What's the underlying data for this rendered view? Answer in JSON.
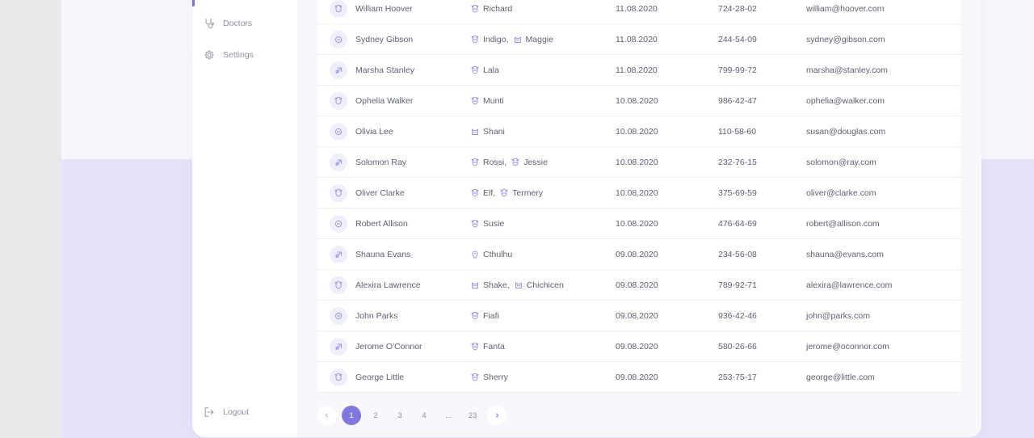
{
  "sidebar": {
    "items": [
      {
        "label": "Doctors",
        "icon": "stethoscope-icon"
      },
      {
        "label": "Settings",
        "icon": "gear-icon"
      }
    ],
    "logout": {
      "label": "Logout",
      "icon": "logout-icon"
    }
  },
  "colors": {
    "accent": "#8178de",
    "icon": "#9b94e6"
  },
  "rows": [
    {
      "name": "William Hoover",
      "pets": [
        {
          "name": "Richard",
          "icon": "dog-icon"
        }
      ],
      "date": "11.08.2020",
      "phone": "724-28-02",
      "email": "william@hoover.com"
    },
    {
      "name": "Sydney Gibson",
      "pets": [
        {
          "name": "Indigo,",
          "icon": "dog-icon"
        },
        {
          "name": "Maggie",
          "icon": "cat-icon"
        }
      ],
      "date": "11.08.2020",
      "phone": "244-54-09",
      "email": "sydney@gibson.com"
    },
    {
      "name": "Marsha Stanley",
      "pets": [
        {
          "name": "Lala",
          "icon": "dog-icon"
        }
      ],
      "date": "11.08.2020",
      "phone": "799-99-72",
      "email": "marsha@stanley.com"
    },
    {
      "name": "Ophelia Walker",
      "pets": [
        {
          "name": "Munti",
          "icon": "dog-icon"
        }
      ],
      "date": "10.08.2020",
      "phone": "986-42-47",
      "email": "ophelia@walker.com"
    },
    {
      "name": "Olivia Lee",
      "pets": [
        {
          "name": "Shani",
          "icon": "cat-icon"
        }
      ],
      "date": "10.08.2020",
      "phone": "110-58-60",
      "email": "susan@douglas.com"
    },
    {
      "name": "Solomon Ray",
      "pets": [
        {
          "name": "Rossi,",
          "icon": "dog-icon"
        },
        {
          "name": "Jessie",
          "icon": "dog-icon"
        }
      ],
      "date": "10.08.2020",
      "phone": "232-76-15",
      "email": "solomon@ray.com"
    },
    {
      "name": "Oliver Clarke",
      "pets": [
        {
          "name": "Elf,",
          "icon": "dog-icon"
        },
        {
          "name": "Termery",
          "icon": "dog-icon"
        }
      ],
      "date": "10.08.2020",
      "phone": "375-69-59",
      "email": "oliver@clarke.com"
    },
    {
      "name": "Robert Allison",
      "pets": [
        {
          "name": "Susie",
          "icon": "dog-icon"
        }
      ],
      "date": "10.08.2020",
      "phone": "476-64-69",
      "email": "robert@allison.com"
    },
    {
      "name": "Shauna Evans",
      "pets": [
        {
          "name": "Cthulhu",
          "icon": "bird-icon"
        }
      ],
      "date": "09.08.2020",
      "phone": "234-56-08",
      "email": "shauna@evans.com"
    },
    {
      "name": "Alexira Lawrence",
      "pets": [
        {
          "name": "Shake,",
          "icon": "cat-icon"
        },
        {
          "name": "Chichicen",
          "icon": "cat-icon"
        }
      ],
      "date": "09.08.2020",
      "phone": "789-92-71",
      "email": "alexira@lawrence.com"
    },
    {
      "name": "John Parks",
      "pets": [
        {
          "name": "Fiafi",
          "icon": "dog-icon"
        }
      ],
      "date": "09.08.2020",
      "phone": "936-42-46",
      "email": "john@parks.com"
    },
    {
      "name": "Jerome O'Connor",
      "pets": [
        {
          "name": "Fanta",
          "icon": "dog-icon"
        }
      ],
      "date": "09.08.2020",
      "phone": "580-26-66",
      "email": "jerome@oconnor.com"
    },
    {
      "name": "George Little",
      "pets": [
        {
          "name": "Sherry",
          "icon": "dog-icon"
        }
      ],
      "date": "09.08.2020",
      "phone": "253-75-17",
      "email": "george@little.com"
    }
  ],
  "pagination": {
    "prev_icon": "chevron-left-icon",
    "next_icon": "chevron-right-icon",
    "pages": [
      "1",
      "2",
      "3",
      "4",
      "...",
      "23"
    ],
    "current": "1"
  }
}
